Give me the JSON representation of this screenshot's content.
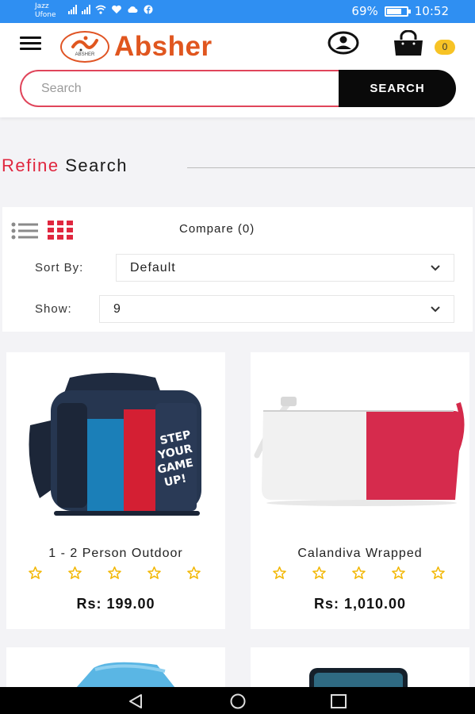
{
  "status_bar": {
    "carrier_line1": "Jazz",
    "carrier_line2": "Ufone",
    "network1": "4G",
    "network2": "3G",
    "battery": "69%",
    "battery_level": 0.69,
    "time": "10:52",
    "icons": [
      "signal-icon",
      "wifi-icon",
      "heart-icon",
      "cloud-icon",
      "facebook-icon"
    ]
  },
  "header": {
    "logo_text": "Absher",
    "logo_emblem_text": "ABSHER",
    "cart_count": "0",
    "search_placeholder": "Search",
    "search_button": "SEARCH"
  },
  "refine": {
    "highlight": "Refine",
    "rest": "Search"
  },
  "filters": {
    "compare": "Compare (0)",
    "sort_label": "Sort By:",
    "sort_value": "Default",
    "show_label": "Show:",
    "show_value": "9"
  },
  "products": [
    {
      "title": "1 - 2 Person Outdoor",
      "price": "Rs: 199.00",
      "rating": 0,
      "max_rating": 5
    },
    {
      "title": "Calandiva Wrapped",
      "price": "Rs: 1,010.00",
      "rating": 0,
      "max_rating": 5
    }
  ],
  "colors": {
    "status_bar": "#2f8ff2",
    "brand_orange": "#e0561f",
    "accent_red": "#e0273f",
    "star_yellow": "#f2b705",
    "badge_yellow": "#f7c325"
  }
}
